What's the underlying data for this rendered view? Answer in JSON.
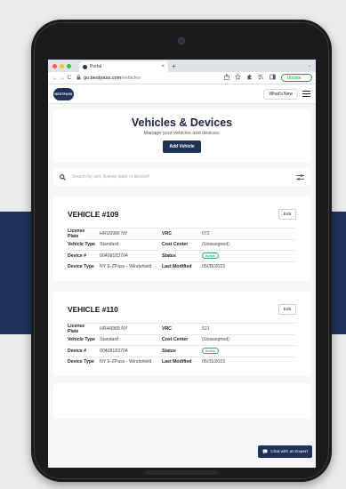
{
  "colors": {
    "brand": "#1f3258",
    "active_green": "#3fa564",
    "update_green": "#2e9b4a"
  },
  "browser": {
    "tab_title": "Portal",
    "tab_close": "×",
    "new_tab": "+",
    "tab_menu": "⌄",
    "nav": {
      "back": "←",
      "forward": "→",
      "reload": "C"
    },
    "url_host": "go.bestpass.com",
    "url_path": "/vehicles",
    "update_label": "Update",
    "update_more": "⋮"
  },
  "app": {
    "logo_text": "BESTPASS",
    "whats_new": "What's New"
  },
  "page": {
    "title": "Vehicles & Devices",
    "subtitle": "Manage your vehicles and devices.",
    "add_vehicle": "Add Vehicle"
  },
  "search": {
    "placeholder": "Search by unit, license plate or device#"
  },
  "labels": {
    "license_plate": "License Plate",
    "vehicle_type": "Vehicle Type",
    "device": "Device #",
    "device_type": "Device Type",
    "vrc": "VRC",
    "cost_center": "Cost Center",
    "status": "Status",
    "last_modified": "Last Modified",
    "edit": "Edit"
  },
  "vehicles": [
    {
      "title": "VEHICLE #109",
      "license_plate": "HRU9986 NY",
      "vehicle_type": "Standard",
      "device": "00408183704",
      "device_type": "NY E-ZPass - Windshield",
      "vrc": "072",
      "cost_center": "(Unassigned)",
      "status": "Active",
      "last_modified": "05/31/2023"
    },
    {
      "title": "VEHICLE #110",
      "license_plate": "HRH9989 NY",
      "vehicle_type": "Standard",
      "device": "00408183704",
      "device_type": "NY E-ZPass - Windshield",
      "vrc": "521",
      "cost_center": "(Unassigned)",
      "status": "Active",
      "last_modified": "05/31/2023"
    }
  ],
  "chat": {
    "label": "Chat with an Expert"
  }
}
